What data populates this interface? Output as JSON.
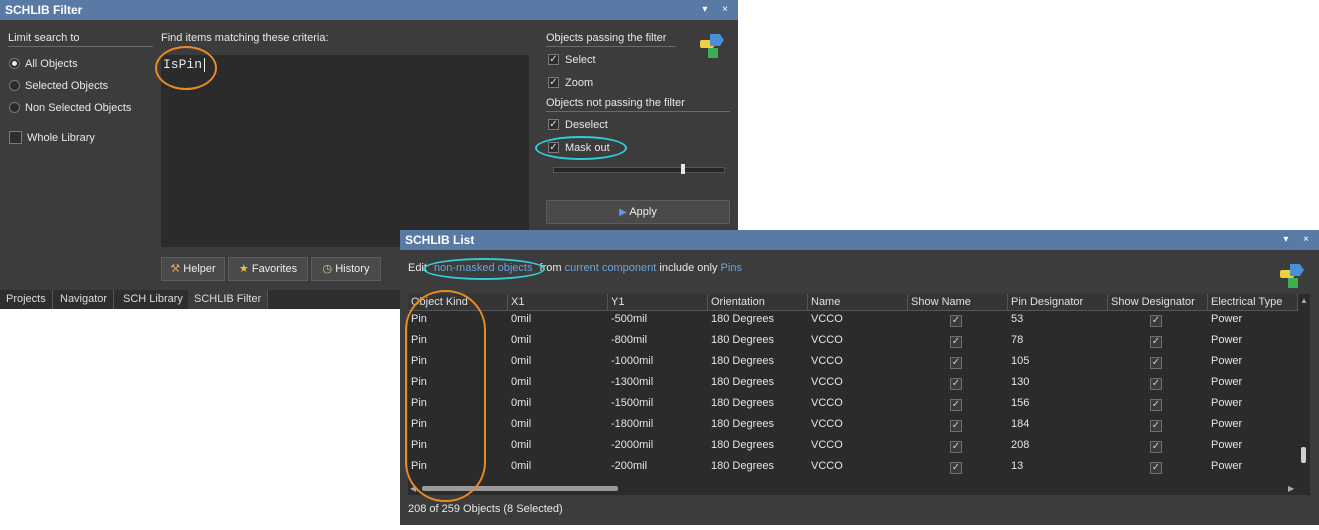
{
  "filter_panel": {
    "title": "SCHLIB Filter",
    "title_buttons": "▾ ×",
    "limit_heading": "Limit search to",
    "scope_options": [
      "All Objects",
      "Selected Objects",
      "Non Selected Objects"
    ],
    "selected_scope": "All Objects",
    "whole_library_label": "Whole Library",
    "whole_library_checked": false,
    "criteria_label": "Find items matching these criteria:",
    "query": "IsPin",
    "passing_heading": "Objects passing the filter",
    "passing_options": [
      {
        "label": "Select",
        "checked": true
      },
      {
        "label": "Zoom",
        "checked": true
      }
    ],
    "not_passing_heading": "Objects not passing the filter",
    "not_passing_options": [
      {
        "label": "Deselect",
        "checked": true
      },
      {
        "label": "Mask out",
        "checked": true
      }
    ],
    "mask_level": 0.77,
    "apply_label": "Apply",
    "helper_label": "Helper",
    "favorites_label": "Favorites",
    "history_label": "History",
    "tabs": [
      "Projects",
      "Navigator",
      "SCH Library",
      "SCHLIB Filter"
    ],
    "active_tab": "SCHLIB Filter"
  },
  "list_panel": {
    "title": "SCHLIB List",
    "title_buttons": "▾ ×",
    "toolbar": {
      "edit": "Edit",
      "scope": "non-masked objects",
      "from": "from",
      "source": "current component",
      "include": "include only",
      "kinds": "Pins"
    },
    "columns": [
      "Object Kind",
      "X1",
      "Y1",
      "Orientation",
      "Name",
      "Show Name",
      "Pin Designator",
      "Show Designator",
      "Electrical Type"
    ],
    "rows": [
      {
        "kind": "Pin",
        "x1": "0mil",
        "y1": "-500mil",
        "orientation": "180 Degrees",
        "name": "VCCO",
        "show_name": true,
        "designator": "53",
        "show_designator": true,
        "etype": "Power"
      },
      {
        "kind": "Pin",
        "x1": "0mil",
        "y1": "-800mil",
        "orientation": "180 Degrees",
        "name": "VCCO",
        "show_name": true,
        "designator": "78",
        "show_designator": true,
        "etype": "Power"
      },
      {
        "kind": "Pin",
        "x1": "0mil",
        "y1": "-1000mil",
        "orientation": "180 Degrees",
        "name": "VCCO",
        "show_name": true,
        "designator": "105",
        "show_designator": true,
        "etype": "Power"
      },
      {
        "kind": "Pin",
        "x1": "0mil",
        "y1": "-1300mil",
        "orientation": "180 Degrees",
        "name": "VCCO",
        "show_name": true,
        "designator": "130",
        "show_designator": true,
        "etype": "Power"
      },
      {
        "kind": "Pin",
        "x1": "0mil",
        "y1": "-1500mil",
        "orientation": "180 Degrees",
        "name": "VCCO",
        "show_name": true,
        "designator": "156",
        "show_designator": true,
        "etype": "Power"
      },
      {
        "kind": "Pin",
        "x1": "0mil",
        "y1": "-1800mil",
        "orientation": "180 Degrees",
        "name": "VCCO",
        "show_name": true,
        "designator": "184",
        "show_designator": true,
        "etype": "Power"
      },
      {
        "kind": "Pin",
        "x1": "0mil",
        "y1": "-2000mil",
        "orientation": "180 Degrees",
        "name": "VCCO",
        "show_name": true,
        "designator": "208",
        "show_designator": true,
        "etype": "Power"
      },
      {
        "kind": "Pin",
        "x1": "0mil",
        "y1": "-200mil",
        "orientation": "180 Degrees",
        "name": "VCCO",
        "show_name": true,
        "designator": "13",
        "show_designator": true,
        "etype": "Power"
      }
    ],
    "status": "208 of 259 Objects (8 Selected)"
  },
  "colors": {
    "title_bar": "#5a7aa6",
    "panel_bg": "#3c3c3c",
    "highlight_orange": "#e98a25",
    "highlight_cyan": "#2ed0d8",
    "link": "#6ea3e0"
  }
}
